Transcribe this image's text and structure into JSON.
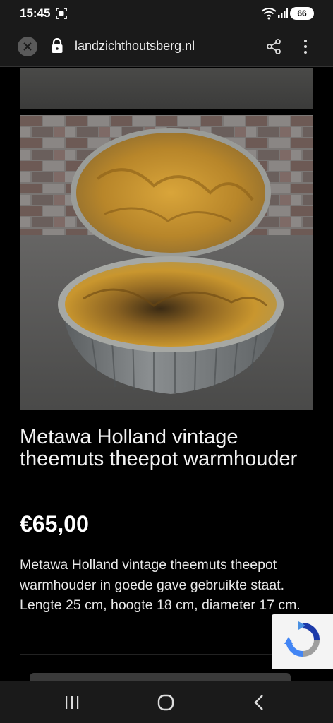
{
  "status_bar": {
    "time": "15:45",
    "battery": "66",
    "icons": [
      "screen-record-icon",
      "wifi-icon",
      "signal-icon",
      "battery-icon"
    ]
  },
  "browser": {
    "url": "landzichthoutsberg.nl",
    "icons": [
      "close-icon",
      "lock-icon",
      "share-icon",
      "more-vert-icon"
    ]
  },
  "product": {
    "title": "Metawa Holland vintage theemuts theepot warmhouder",
    "price": "€65,00",
    "description": "Metawa Holland vintage theemuts theepot warmhouder in goede gave gebruikte staat. Lengte 25 cm, hoogte 18 cm, diameter 17 cm."
  },
  "colors": {
    "background": "#000000",
    "bar": "#1a1a1a",
    "lining": "#c8962a",
    "metal": "#7a7e80"
  },
  "nav": {
    "icons": [
      "recent-apps-icon",
      "home-icon",
      "back-icon"
    ]
  }
}
